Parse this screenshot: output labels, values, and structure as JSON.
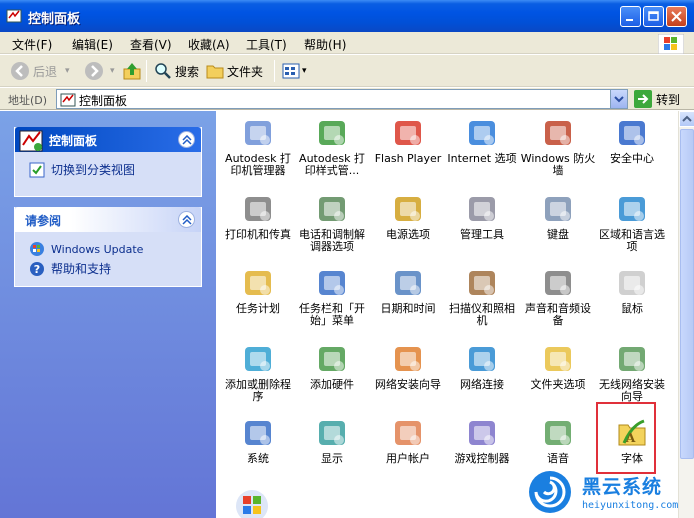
{
  "window": {
    "title": "控制面板"
  },
  "menu": [
    "文件(F)",
    "编辑(E)",
    "查看(V)",
    "收藏(A)",
    "工具(T)",
    "帮助(H)"
  ],
  "toolbar": {
    "back": "后退",
    "search": "搜索",
    "folders": "文件夹"
  },
  "address": {
    "label": "地址(D)",
    "value": "控制面板",
    "go": "转到"
  },
  "side": {
    "cp_title": "控制面板",
    "switch_view": "切换到分类视图",
    "see_also_title": "请参阅",
    "windows_update": "Windows Update",
    "help": "帮助和支持"
  },
  "items": [
    "Autodesk 打印机管理器",
    "Autodesk 打印样式管...",
    "Flash Player",
    "Internet 选项",
    "Windows 防火墙",
    "安全中心",
    "打印机和传真",
    "电话和调制解调器选项",
    "电源选项",
    "管理工具",
    "键盘",
    "区域和语言选项",
    "任务计划",
    "任务栏和「开始」菜单",
    "日期和时间",
    "扫描仪和照相机",
    "声音和音频设备",
    "鼠标",
    "添加或删除程序",
    "添加硬件",
    "网络安装向导",
    "网络连接",
    "文件夹选项",
    "无线网络安装向导",
    "系统",
    "显示",
    "用户帐户",
    "游戏控制器",
    "语音",
    "字体"
  ],
  "watermark": {
    "title": "黑云系统",
    "url": "heiyunxitong.com"
  }
}
